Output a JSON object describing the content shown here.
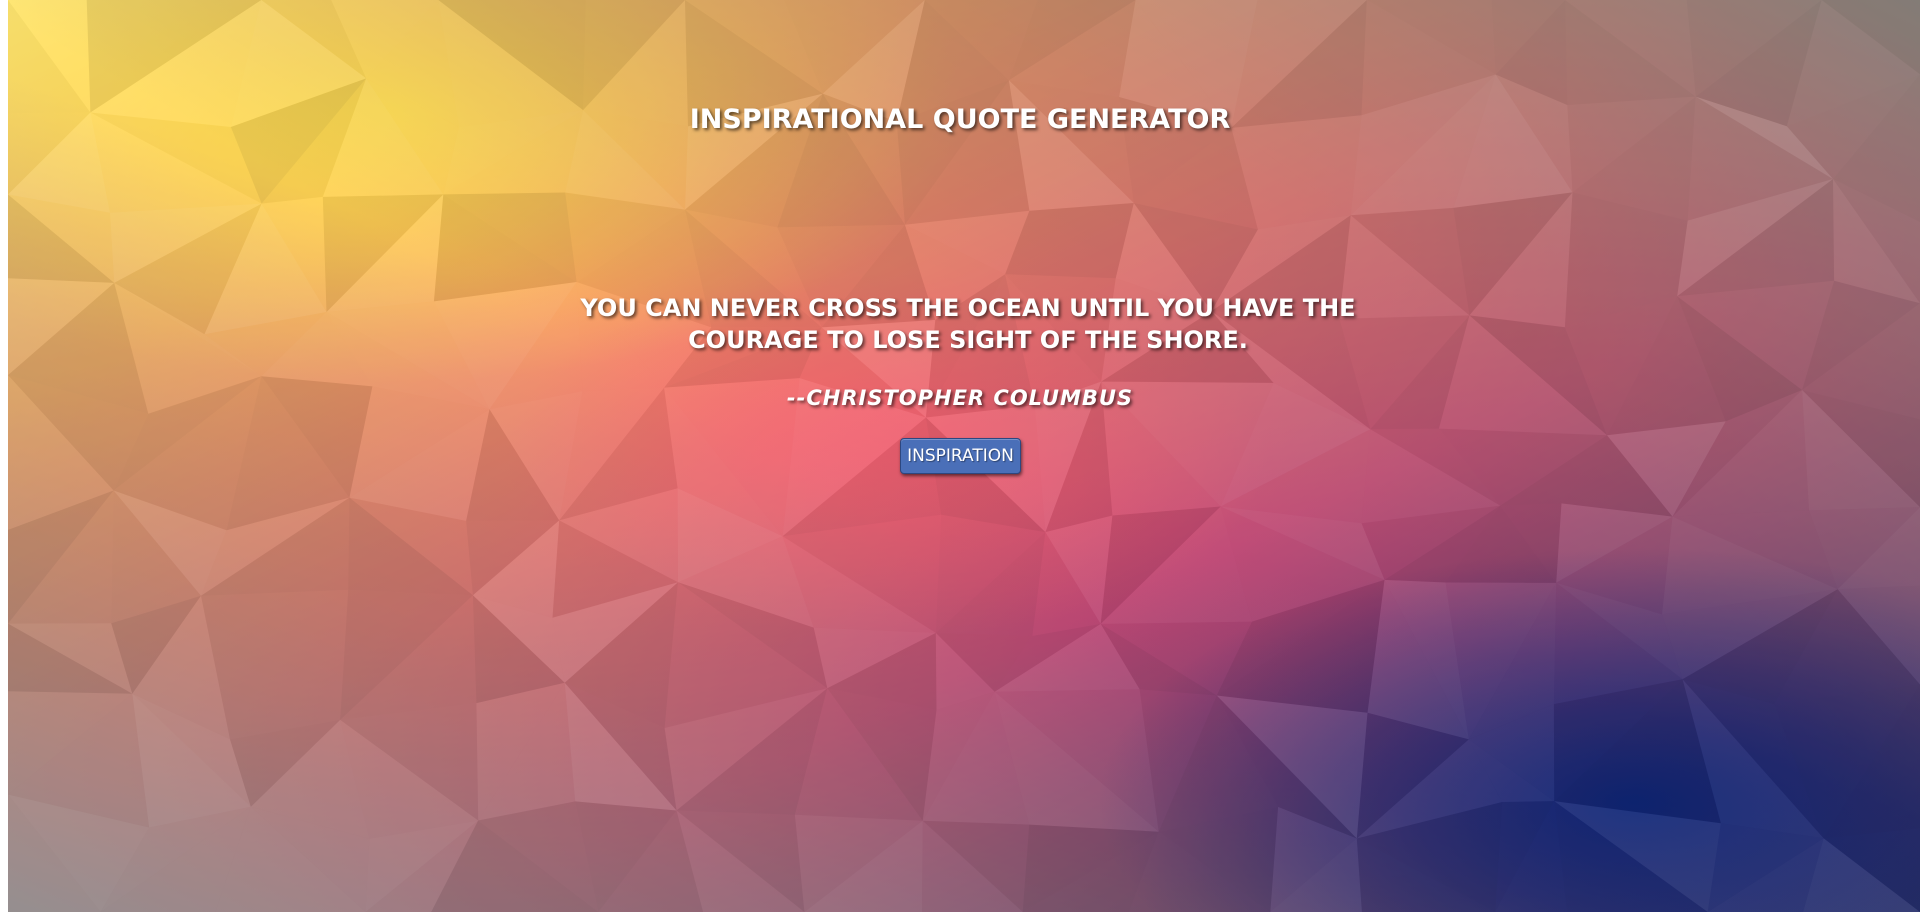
{
  "page": {
    "title": "INSPIRATIONAL QUOTE GENERATOR",
    "quote_line_1": "YOU CAN NEVER CROSS THE OCEAN UNTIL YOU HAVE THE",
    "quote_line_2": "COURAGE TO LOSE SIGHT OF THE SHORE.",
    "author": "--CHRISTOPHER COLUMBUS",
    "button_label": "INSPIRATION"
  },
  "colors": {
    "gradient_top_left": "#ffe46a",
    "gradient_mid": "#f0607a",
    "gradient_right": "#8a2f6e",
    "gradient_bottom_right": "#0b1e66",
    "gradient_bottom_left": "#8c8a88",
    "button": "#4a6fb8",
    "text": "#ffffff"
  }
}
